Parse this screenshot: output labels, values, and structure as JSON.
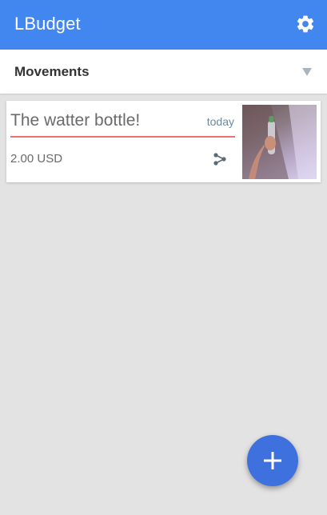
{
  "app": {
    "title": "LBudget",
    "primary_color": "#4287f0",
    "settings_icon": "gear-icon"
  },
  "filter": {
    "selected": "Movements",
    "dropdown_icon": "triangle-down-icon"
  },
  "movements": [
    {
      "title": "The watter bottle!",
      "date": "today",
      "amount": "2.00 USD",
      "share_icon": "share-icon",
      "underline_color": "#ee7070"
    }
  ],
  "fab": {
    "icon": "plus-icon",
    "color": "#3f71de"
  }
}
